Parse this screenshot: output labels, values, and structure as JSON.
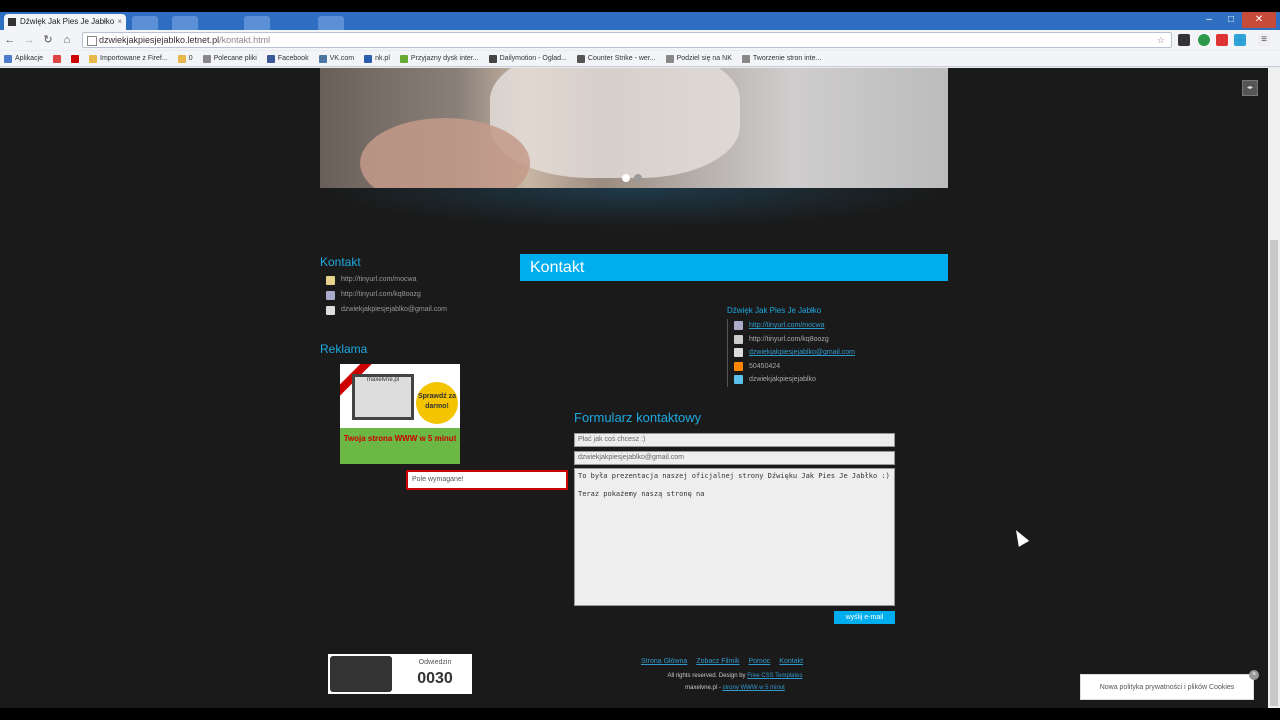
{
  "browser": {
    "tab_title": "Dźwięk Jak Pies Je Jabłko",
    "url_host": "dzwiekjakpiesjejablko.letnet.pl",
    "url_path": "/kontakt.html",
    "bookmarks": [
      {
        "label": "Aplikacje",
        "color": "#4a7bd0"
      },
      {
        "label": "",
        "color": "#d44"
      },
      {
        "label": "",
        "color": "#c00"
      },
      {
        "label": "Importowane z Firef...",
        "color": "#e6b84b"
      },
      {
        "label": "0",
        "color": "#e6b84b"
      },
      {
        "label": "Polecane pliki",
        "color": "#888"
      },
      {
        "label": "Facebook",
        "color": "#3b5998"
      },
      {
        "label": "VK.com",
        "color": "#4c75a3"
      },
      {
        "label": "nk.pl",
        "color": "#2a5db0"
      },
      {
        "label": "Przyjazny dysk inter...",
        "color": "#6a3"
      },
      {
        "label": "Dailymotion - Oglad...",
        "color": "#444"
      },
      {
        "label": "Counter Strike - wer...",
        "color": "#555"
      },
      {
        "label": "Podziel się na NK",
        "color": "#888"
      },
      {
        "label": "Tworzenie stron inte...",
        "color": "#888"
      }
    ]
  },
  "sidebar": {
    "contact_heading": "Kontakt",
    "contact_items": [
      {
        "text": "http://tinyurl.com/mocwa",
        "color": "#e6d28a"
      },
      {
        "text": "http://tinyurl.com/kq8oozg",
        "color": "#aac"
      },
      {
        "text": "dzwiekjakpiesjejablko@gmail.com",
        "color": "#ddd"
      }
    ],
    "ad_heading": "Reklama",
    "ad": {
      "brand": "maxelvne.pl",
      "badge": "Sprawdź za darmo!",
      "bottom_text": "Twoja strona WWW w 5 minut"
    },
    "required_error": "Pole wymagane!"
  },
  "main": {
    "title": "Kontakt",
    "info_heading": "Dźwięk Jak Pies Je Jabłko",
    "info_items": [
      {
        "text": "http://tinyurl.com/mocwa",
        "link": true,
        "color": "#aac"
      },
      {
        "text": "http://tinyurl.com/kq8oozg",
        "link": false,
        "color": "#ccc"
      },
      {
        "text": "dzwiekjakpiesjejablko@gmail.com",
        "link": true,
        "color": "#ddd"
      },
      {
        "text": "50450424",
        "link": false,
        "color": "#f80"
      },
      {
        "text": "dzwiekjakpiesjejablko",
        "link": false,
        "color": "#5bc0eb"
      }
    ],
    "form": {
      "heading": "Formularz kontaktowy",
      "subject_placeholder": "Płać jak coś chcesz :)",
      "email_value": "dzwiekjakpiesjejablko@gmail.com",
      "message_value": "To była prezentacja naszej oficjalnej strony Dźwięku Jak Pies Je Jabłko :)\n\nTeraz pokażemy naszą stronę na",
      "send_label": "wyślij e-mail"
    }
  },
  "counter": {
    "label": "Odwiedzin",
    "value": "0030"
  },
  "footer": {
    "links": [
      "Strona Główna",
      "Zobacz Filmik",
      "Pomoc",
      "Kontakt"
    ],
    "rights_prefix": "All rights reserved. Design by",
    "rights_link": "Free CSS Templates",
    "powered_prefix": "maxelvne.pl -",
    "powered_link": "strony WWW w 5 minut"
  },
  "cookie": {
    "text": "Nowa polityka prywatności i plików Cookies",
    "close": "×"
  },
  "window": {
    "minimize": "–",
    "maximize": "□",
    "close": "✕"
  }
}
